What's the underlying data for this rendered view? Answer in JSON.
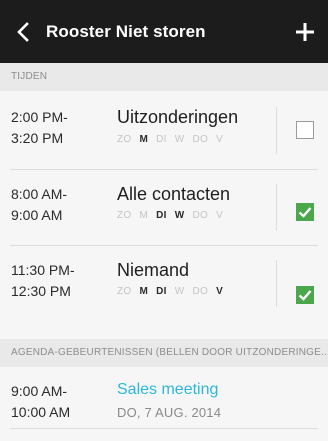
{
  "header": {
    "title": "Rooster Niet storen",
    "back_icon": "chevron-left-icon",
    "add_icon": "plus-icon"
  },
  "sections": {
    "times_label": "TIJDEN",
    "events_label": "AGENDA-GEBEURTENISSEN (BELLEN DOOR UITZONDERINGE..."
  },
  "rules": [
    {
      "start": "2:00 PM-",
      "end": "3:20 PM",
      "name": "Uitzonderingen",
      "days": [
        {
          "label": "ZO",
          "on": false
        },
        {
          "label": "M",
          "on": true
        },
        {
          "label": "DI",
          "on": false
        },
        {
          "label": "W",
          "on": false
        },
        {
          "label": "DO",
          "on": false
        },
        {
          "label": "V",
          "on": false
        }
      ],
      "checked": false
    },
    {
      "start": "8:00 AM-",
      "end": "9:00 AM",
      "name": "Alle contacten",
      "days": [
        {
          "label": "ZO",
          "on": false
        },
        {
          "label": "M",
          "on": false
        },
        {
          "label": "DI",
          "on": true
        },
        {
          "label": "W",
          "on": true
        },
        {
          "label": "DO",
          "on": false
        },
        {
          "label": "V",
          "on": false
        }
      ],
      "checked": true
    },
    {
      "start": "11:30 PM-",
      "end": "12:30 PM",
      "name": "Niemand",
      "days": [
        {
          "label": "ZO",
          "on": false
        },
        {
          "label": "M",
          "on": true
        },
        {
          "label": "DI",
          "on": true
        },
        {
          "label": "W",
          "on": false
        },
        {
          "label": "DO",
          "on": false
        },
        {
          "label": "V",
          "on": true
        }
      ],
      "checked": true
    }
  ],
  "events": [
    {
      "start": "9:00 AM-",
      "end": "10:00 AM",
      "title": "Sales meeting",
      "date": "DO, 7 AUG. 2014"
    }
  ],
  "colors": {
    "appbar": "#1c1c1c",
    "check_green": "#4ca64c",
    "event_title": "#2cb8d9"
  }
}
